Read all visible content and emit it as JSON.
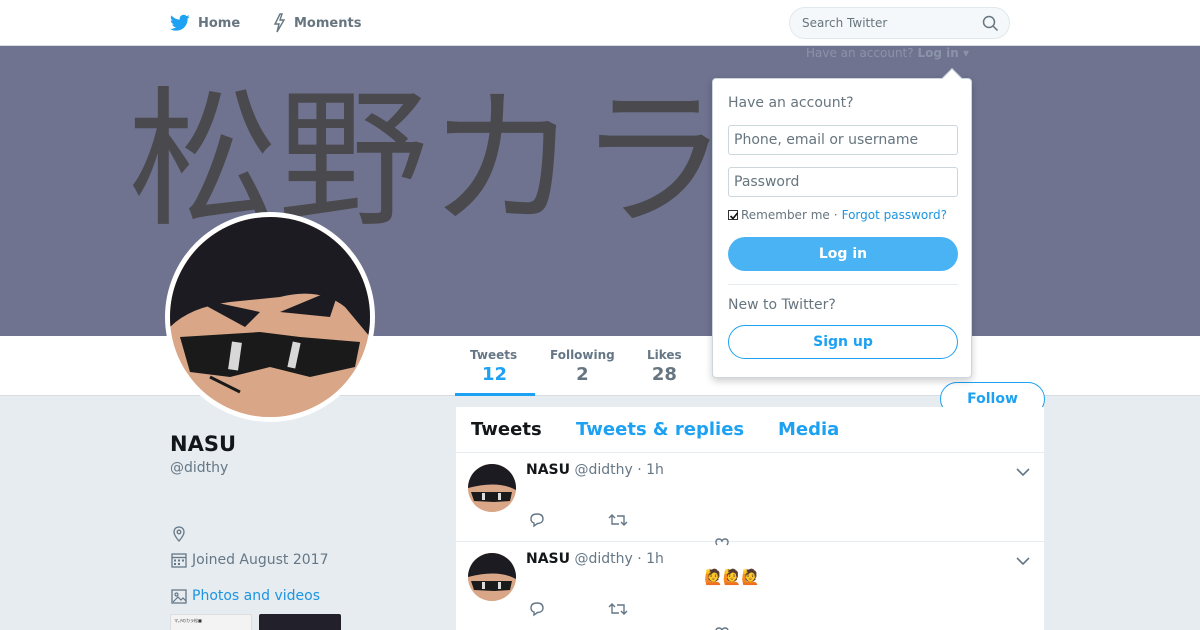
{
  "nav": {
    "home_label": "Home",
    "moments_label": "Moments",
    "search_placeholder": "Search Twitter",
    "home_icon": "twitter-bird-icon",
    "moments_icon": "lightning-icon",
    "search_icon": "magnifier-icon"
  },
  "header": {
    "banner_text": "松野カラ",
    "have_account_prompt": "Have an account?",
    "login_link": "Log in ▾"
  },
  "stats": [
    {
      "label": "Tweets",
      "value": "12"
    },
    {
      "label": "Following",
      "value": "2"
    },
    {
      "label": "Likes",
      "value": "28"
    }
  ],
  "follow_button": "Follow",
  "profile": {
    "name": "NASU",
    "handle": "@didthy",
    "joined": "Joined August 2017",
    "photos_link": "Photos and videos",
    "thumb1_text": "マ｡ﾁのカラ松■"
  },
  "timeline": {
    "tabs": [
      "Tweets",
      "Tweets & replies",
      "Media"
    ],
    "tweets": [
      {
        "name": "NASU",
        "handle": "@didthy",
        "time": "· 1h",
        "text": ""
      },
      {
        "name": "NASU",
        "handle": "@didthy",
        "time": "· 1h",
        "text": "🙋🙋🙋"
      }
    ]
  },
  "login": {
    "title": "Have an account?",
    "username_placeholder": "Phone, email or username",
    "password_placeholder": "Password",
    "remember_label": "Remember me",
    "separator": "·",
    "forgot_label": "Forgot password?",
    "login_button": "Log in",
    "new_title": "New to Twitter?",
    "signup_button": "Sign up"
  },
  "colors": {
    "accent": "#1da1f2",
    "banner": "#6f7390",
    "background": "#e6ecf0"
  }
}
